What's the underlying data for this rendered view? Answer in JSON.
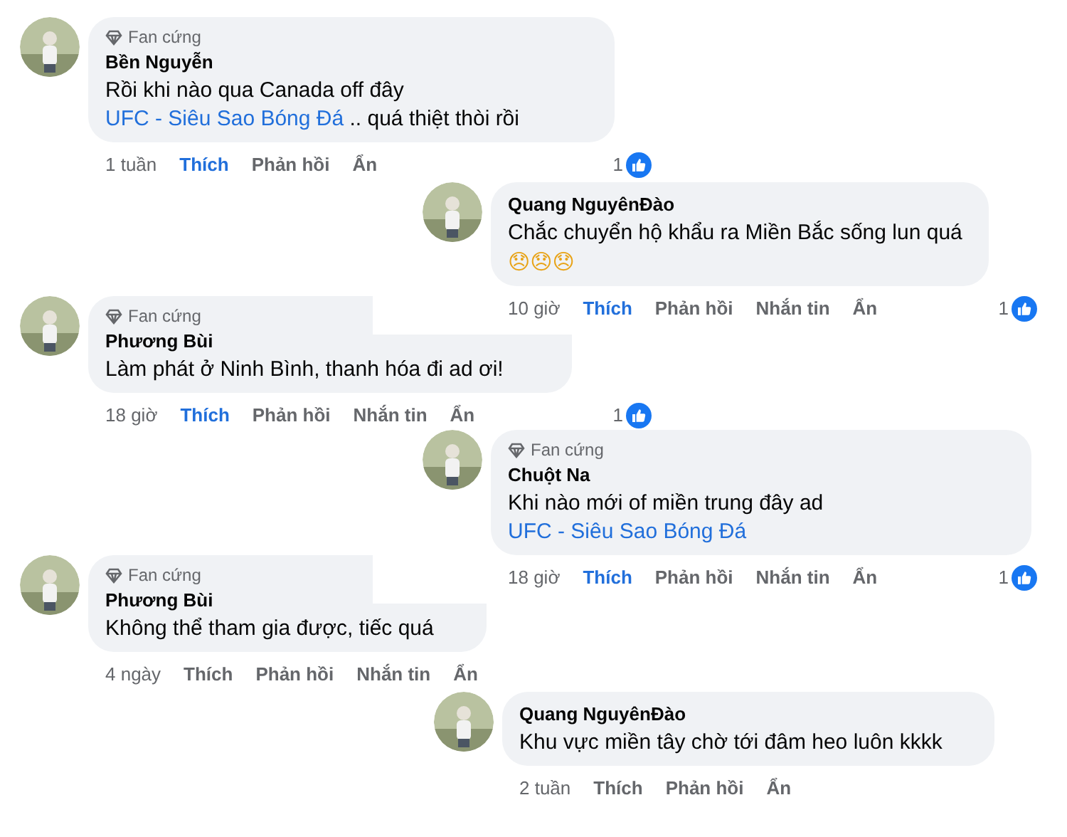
{
  "comments": [
    {
      "kind": "left",
      "badge": "Fan cứng",
      "author": "Bền Nguyễn",
      "text": [
        {
          "kind": "plain",
          "text": "Rồi khi nào qua Canada off đây "
        },
        {
          "kind": "link",
          "text": "UFC - Siêu Sao Bóng Đá"
        },
        {
          "kind": "plain",
          "text": " ..  quá thiệt thòi rồi"
        }
      ],
      "time": "1 tuần",
      "like_label": "Thích",
      "liked": true,
      "other_actions": [
        "Phản hồi",
        "Ẩn"
      ],
      "reaction_count": "1"
    },
    {
      "kind": "right",
      "author": "Quang NguyênĐào",
      "text": [
        {
          "kind": "plain",
          "text": "Chắc chuyển hộ khẩu ra Miền Bắc sống lun quá "
        },
        {
          "kind": "emoji",
          "text": "😞😞😞"
        }
      ],
      "time": "10 giờ",
      "like_label": "Thích",
      "liked": true,
      "other_actions": [
        "Phản hồi",
        "Nhắn tin",
        "Ẩn"
      ],
      "reaction_count": "1"
    },
    {
      "kind": "left",
      "badge": "Fan cứng",
      "author": "Phương Bùi",
      "text": [
        {
          "kind": "plain",
          "text": "Làm phát ở Ninh Bình, thanh hóa đi ad ơi!"
        }
      ],
      "time": "18 giờ",
      "like_label": "Thích",
      "liked": true,
      "other_actions": [
        "Phản hồi",
        "Nhắn tin",
        "Ẩn"
      ],
      "reaction_count": "1"
    },
    {
      "kind": "right",
      "badge": "Fan cứng",
      "author": "Chuột Na",
      "text": [
        {
          "kind": "plain",
          "text": "Khi nào mới of miền trung đây ad "
        },
        {
          "kind": "link",
          "text": "UFC - Siêu Sao Bóng Đá"
        }
      ],
      "time": "18 giờ",
      "like_label": "Thích",
      "liked": true,
      "other_actions": [
        "Phản hồi",
        "Nhắn tin",
        "Ẩn"
      ],
      "reaction_count": "1"
    },
    {
      "kind": "left",
      "badge": "Fan cứng",
      "author": "Phương Bùi",
      "text": [
        {
          "kind": "plain",
          "text": "Không thể tham gia được, tiếc quá"
        }
      ],
      "time": "4 ngày",
      "like_label": "Thích",
      "liked": false,
      "other_actions": [
        "Phản hồi",
        "Nhắn tin",
        "Ẩn"
      ]
    },
    {
      "kind": "right",
      "author": "Quang NguyênĐào",
      "text": [
        {
          "kind": "plain",
          "text": "Khu vực miền tây chờ tới đâm heo luôn kkkk"
        }
      ],
      "time": "2 tuần",
      "like_label": "Thích",
      "liked": false,
      "other_actions": [
        "Phản hồi",
        "Ẩn"
      ]
    }
  ]
}
